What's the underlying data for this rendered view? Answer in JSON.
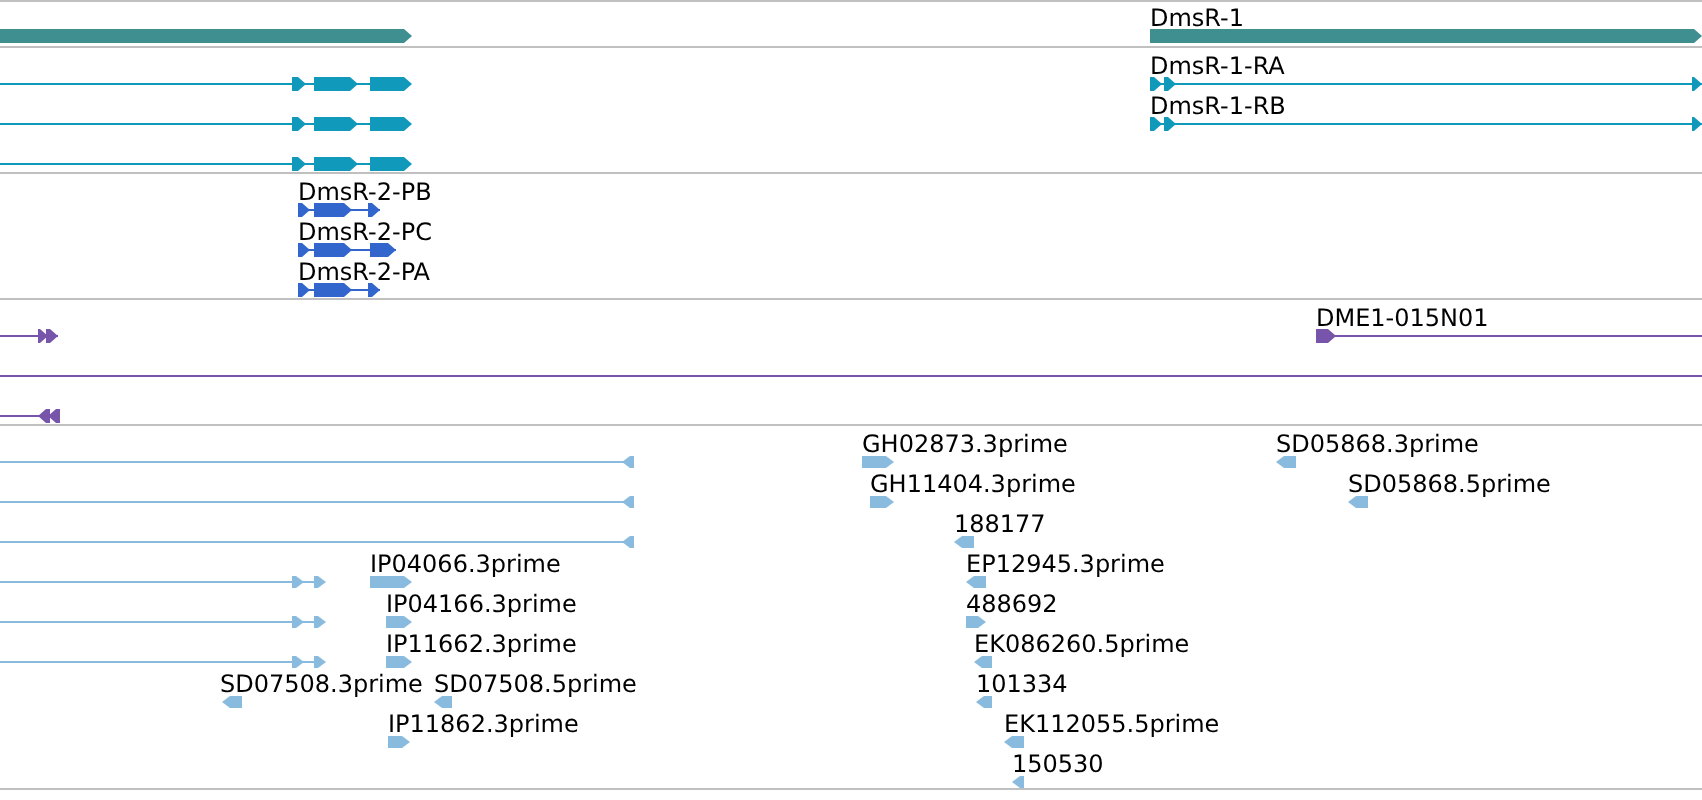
{
  "tracks": [
    {
      "color": "#3f8f91",
      "features": [
        {
          "reverse": false
        },
        {
          "label": "DmsR-1",
          "reverse": false
        }
      ]
    },
    {
      "color": "#1199bb",
      "features": [
        {
          "reverse": false
        },
        {
          "reverse": false
        },
        {
          "reverse": false
        },
        {
          "label": "DmsR-1-RA",
          "reverse": false
        },
        {
          "label": "DmsR-1-RB",
          "reverse": false
        }
      ]
    },
    {
      "color": "#3366cc",
      "features": [
        {
          "label": "DmsR-2-PB",
          "reverse": false
        },
        {
          "label": "DmsR-2-PC",
          "reverse": false
        },
        {
          "label": "DmsR-2-PA",
          "reverse": false
        }
      ]
    },
    {
      "color": "#7755aa",
      "features": [
        {
          "kind": "clone",
          "reverse": false
        },
        {
          "kind": "clone",
          "label": "DME1-015N01",
          "reverse": false
        },
        {
          "kind": "span"
        },
        {
          "kind": "clone",
          "reverse": true
        }
      ]
    },
    {
      "color": "#88bbdd",
      "features": [
        {
          "reverse": true
        },
        {
          "reverse": true
        },
        {
          "reverse": true
        },
        {
          "reverse": false
        },
        {
          "reverse": false
        },
        {
          "reverse": false
        },
        {
          "label": "IP04066.3prime",
          "reverse": false
        },
        {
          "label": "IP04166.3prime",
          "reverse": false
        },
        {
          "label": "IP11662.3prime",
          "reverse": false
        },
        {
          "label": "SD07508.3prime",
          "reverse": true
        },
        {
          "label": "SD07508.5prime",
          "reverse": true
        },
        {
          "label": "IP11862.3prime",
          "reverse": false
        },
        {
          "label": "GH02873.3prime",
          "reverse": false
        },
        {
          "label": "GH11404.3prime",
          "reverse": false
        },
        {
          "label": "188177",
          "reverse": true
        },
        {
          "label": "EP12945.3prime",
          "reverse": true
        },
        {
          "label": "488692",
          "reverse": false
        },
        {
          "label": "EK086260.5prime",
          "reverse": true
        },
        {
          "label": "101334",
          "reverse": true
        },
        {
          "label": "EK112055.5prime",
          "reverse": true
        },
        {
          "label": "150530",
          "reverse": true
        },
        {
          "label": "SD05868.3prime",
          "reverse": true
        },
        {
          "label": "SD05868.5prime",
          "reverse": true
        }
      ]
    }
  ]
}
